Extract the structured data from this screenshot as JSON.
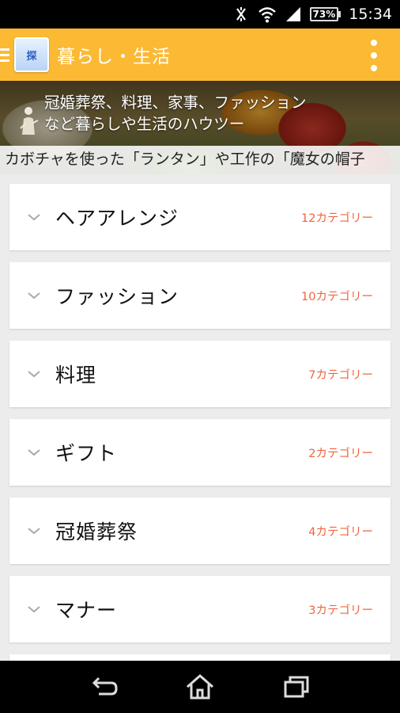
{
  "status_bar": {
    "time": "15:34",
    "battery": "73%",
    "icons": [
      "nfc-off-icon",
      "wifi-icon",
      "signal-icon",
      "battery-icon"
    ]
  },
  "app_bar": {
    "title": "暮らし・生活",
    "logo_text": "探",
    "accent_color": "#fbb934"
  },
  "banner": {
    "headline_line1": "冠婚葬祭、料理、家事、ファッション",
    "headline_line2": "など暮らしや生活のハウツー",
    "ticker": "カボチャを使った「ランタン」や工作の「魔女の帽子"
  },
  "categories": [
    {
      "title": "ヘアアレンジ",
      "count": "12カテゴリー"
    },
    {
      "title": "ファッション",
      "count": "10カテゴリー"
    },
    {
      "title": "料理",
      "count": "7カテゴリー"
    },
    {
      "title": "ギフト",
      "count": "2カテゴリー"
    },
    {
      "title": "冠婚葬祭",
      "count": "4カテゴリー"
    },
    {
      "title": "マナー",
      "count": "3カテゴリー"
    }
  ],
  "count_color": "#f0653b",
  "nav_bar": {
    "buttons": [
      "back-icon",
      "home-icon",
      "recent-apps-icon"
    ]
  }
}
